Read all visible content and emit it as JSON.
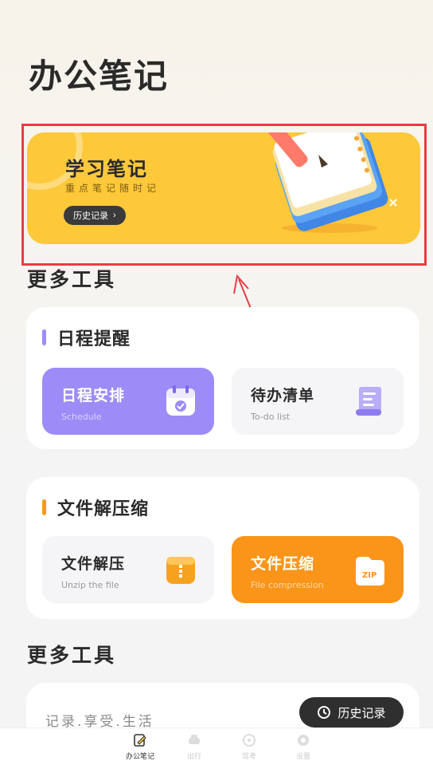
{
  "page": {
    "title": "办公笔记"
  },
  "hero": {
    "title": "学习笔记",
    "subtitle": "重点笔记随时记",
    "button": "历史记录"
  },
  "sections": {
    "more_tools_1": "更多工具",
    "more_tools_2": "更多工具"
  },
  "schedule": {
    "title": "日程提醒",
    "accent": "#9d8cf7",
    "tiles": [
      {
        "name": "日程安排",
        "en": "Schedule",
        "icon": "calendar-icon"
      },
      {
        "name": "待办清单",
        "en": "To-do list",
        "icon": "scroll-list-icon"
      }
    ]
  },
  "files": {
    "title": "文件解压缩",
    "accent": "#f59a1c",
    "tiles": [
      {
        "name": "文件解压",
        "en": "Unzip the file",
        "icon": "zip-box-icon"
      },
      {
        "name": "文件压缩",
        "en": "File compression",
        "icon": "zip-folder-icon"
      }
    ]
  },
  "footer": {
    "slogan": "记录.享受.生活",
    "history_button": "历史记录"
  },
  "tabbar": [
    {
      "label": "办公笔记",
      "icon": "note-icon",
      "active": true
    },
    {
      "label": "出行",
      "icon": "car-icon",
      "active": false
    },
    {
      "label": "驾考",
      "icon": "steering-wheel-icon",
      "active": false
    },
    {
      "label": "设置",
      "icon": "gear-icon",
      "active": false
    }
  ],
  "colors": {
    "hero": "#fdc83a",
    "highlight": "#e93b44",
    "schedule_tile": "#9d8cf7",
    "compress_tile": "#fa951a"
  }
}
